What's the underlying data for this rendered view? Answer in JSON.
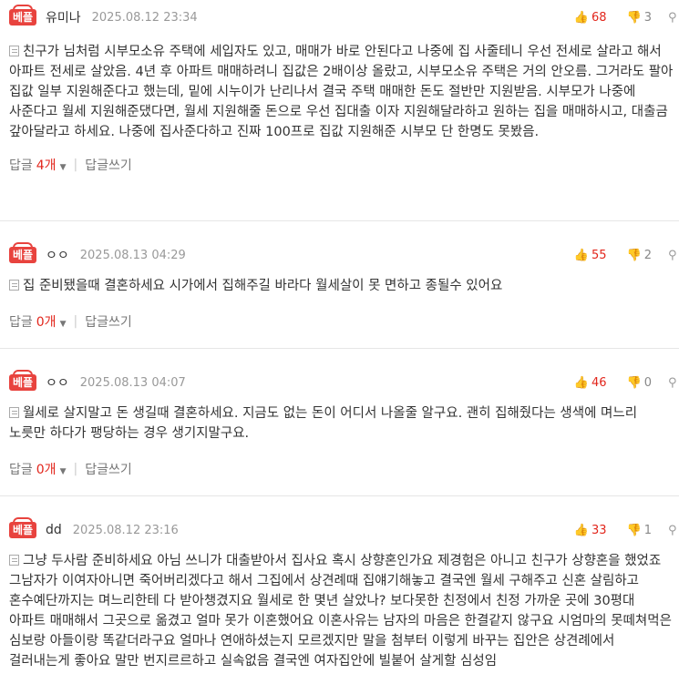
{
  "comments": [
    {
      "badge": "베플",
      "author": "유미나",
      "date": "2025.08.12 23:34",
      "up": "68",
      "down": "3",
      "text": "친구가 님처럼 시부모소유 주택에 세입자도 있고, 매매가 바로 안된다고 나중에 집 사줄테니 우선 전세로 살라고 해서 아파트 전세로 살았음. 4년 후 아파트 매매하려니 집값은 2배이상 올랐고, 시부모소유 주택은 거의 안오름. 그거라도 팔아 집값 일부 지원해준다고 했는데, 밑에 시누이가 난리나서 결국 주택 매매한 돈도 절반만 지원받음. 시부모가 나중에 사준다고 월세 지원해준댔다면, 월세 지원해줄 돈으로 우선 집대출 이자 지원해달라하고 원하는 집을 매매하시고, 대출금 갚아달라고 하세요. 나중에 집사준다하고 진짜 100프로 집값 지원해준 시부모 단 한명도 못봤음.",
      "reply_label": "답글",
      "reply_count": "4개",
      "write_reply": "답글쓰기"
    },
    {
      "badge": "베플",
      "author": "ㅇㅇ",
      "date": "2025.08.13 04:29",
      "up": "55",
      "down": "2",
      "text": "집 준비됐을때 결혼하세요 시가에서 집해주길 바라다 월세살이 못 면하고 종될수 있어요",
      "reply_label": "답글",
      "reply_count": "0개",
      "write_reply": "답글쓰기"
    },
    {
      "badge": "베플",
      "author": "ㅇㅇ",
      "date": "2025.08.13 04:07",
      "up": "46",
      "down": "0",
      "text": "월세로 살지말고 돈 생길때 결혼하세요. 지금도 없는 돈이 어디서 나올줄 알구요. 괜히 집해줬다는 생색에 며느리 노릇만 하다가 팽당하는 경우 생기지말구요.",
      "reply_label": "답글",
      "reply_count": "0개",
      "write_reply": "답글쓰기"
    },
    {
      "badge": "베플",
      "author": "dd",
      "date": "2025.08.12 23:16",
      "up": "33",
      "down": "1",
      "text": "그냥 두사람 준비하세요 아님 쓰니가 대출받아서 집사요 혹시 상향혼인가요 제경험은 아니고 친구가 상향혼을 했었죠 그남자가 이여자아니면 죽어버리겠다고 해서 그집에서 상견례때 집얘기해놓고 결국엔 월세 구해주고 신혼 살림하고 혼수예단까지는 며느리한테 다 받아챙겼지요 월세로 한 몇년 살았나? 보다못한 친정에서 친정 가까운 곳에 30평대 아파트 매매해서 그곳으로 옮겼고 얼마 못가 이혼했어요 이혼사유는 남자의 마음은 한결같지 않구요 시엄마의 못떼쳐먹은 심보랑 아들이랑 똑같더라구요 얼마나 연애하셨는지 모르겠지만 말을 첨부터 이렇게 바꾸는 집안은 상견례에서 걸러내는게 좋아요 말만 번지르르하고 실속없음 결국엔 여자집안에 빌붙어 살게할 심성임"
    }
  ]
}
